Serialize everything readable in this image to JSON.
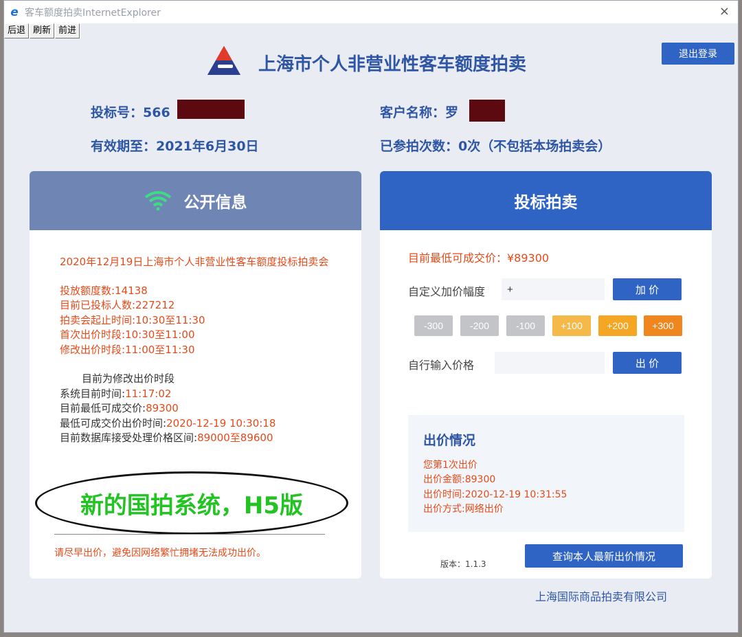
{
  "window": {
    "title": "客车额度拍卖InternetExplorer",
    "close_symbol": "×",
    "toolbar": {
      "back": "后退",
      "refresh": "刷新",
      "forward": "前进"
    }
  },
  "header": {
    "title": "上海市个人非营业性客车额度拍卖",
    "logout": "退出登录"
  },
  "user": {
    "bid_no_label": "投标号：",
    "bid_no": "566",
    "valid_until": "有效期至：2021年6月30日",
    "client_label": "客户名称：",
    "client_name": "罗",
    "participated": "已参拍次数：0次（不包括本场拍卖会）"
  },
  "public_info": {
    "title": "公开信息",
    "auction_name": "2020年12月19日上海市个人非营业性客车额度投标拍卖会",
    "lines": [
      "投放额度数:14138",
      "目前已投标人数:227212",
      "拍卖会起止时间:10:30至11:30",
      "首次出价时段:10:30至11:00",
      "修改出价时段:11:00至11:30"
    ],
    "phase": "目前为修改出价时段",
    "status": [
      {
        "label": "系统目前时间:",
        "value": "11:17:02"
      },
      {
        "label": "目前最低可成交价:",
        "value": "89300"
      },
      {
        "label": "最低可成交价出价时间:",
        "value": "2020-12-19 10:30:18"
      },
      {
        "label": "目前数据库接受处理价格区间:",
        "value": "89000至89600"
      }
    ],
    "annotation": "新的国拍系统，H5版",
    "warning": "请尽早出价，避免因网络繁忙拥堵无法成功出价。"
  },
  "bidding": {
    "title": "投标拍卖",
    "lowest_price": "目前最低可成交价：¥89300",
    "custom_label": "自定义加价幅度",
    "custom_value": "+",
    "add_btn": "加 价",
    "steps": [
      "-300",
      "-200",
      "-100",
      "+100",
      "+200",
      "+300"
    ],
    "input_label": "自行输入价格",
    "bid_btn": "出 价",
    "record": {
      "title": "出价情况",
      "lines": [
        "您第1次出价",
        "出价金额:89300",
        "出价时间:2020-12-19 10:31:55",
        "出价方式:网络出价"
      ]
    },
    "version": "版本：1.1.3",
    "query_btn": "查询本人最新出价情况"
  },
  "footer": {
    "company": "上海国际商品拍卖有限公司"
  },
  "colors": {
    "brand": "#2f56a5",
    "accent": "#2f63c4",
    "alert": "#e64a19",
    "annotation": "#22c322"
  }
}
